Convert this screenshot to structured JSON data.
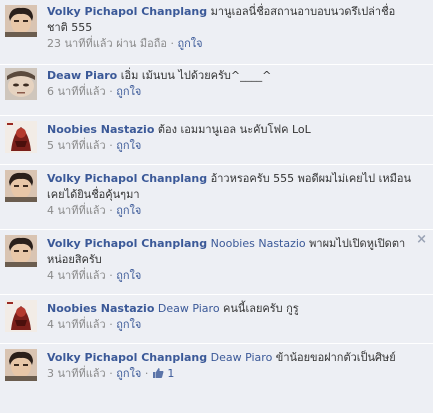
{
  "comments": [
    {
      "author": "Volky Pichapol Chanplang",
      "text": " มานูเอลนี่ชื่อสถานอาบอบนวดรึเปล่าชื่อชาติ 555",
      "time": "23 นาทีที่แล้ว",
      "via": "ผ่าน มือถือ",
      "like": "ถูกใจ",
      "avatar": "avatar-volky"
    },
    {
      "author": "Deaw Piaro",
      "text": " เอิ่ม เม้นบน ไปด้วยครับ^____^",
      "time": "6 นาทีที่แล้ว",
      "like": "ถูกใจ",
      "avatar": "avatar-deaw"
    },
    {
      "author": "Noobies Nastazio",
      "text": " ต้อง เอมมานูเอล นะคับโฟค LoL",
      "time": "5 นาทีที่แล้ว",
      "like": "ถูกใจ",
      "avatar": "avatar-noobies"
    },
    {
      "author": "Volky Pichapol Chanplang",
      "text": " อ้าวหรอครับ 555 พอดีผมไม่เคยไป เหมือนเคยได้ยินชื่อคุ้นๆมา",
      "time": "4 นาทีที่แล้ว",
      "like": "ถูกใจ",
      "avatar": "avatar-volky"
    },
    {
      "author": "Volky Pichapol Chanplang",
      "mention": "Noobies Nastazio",
      "text": " พาผมไปเปิดหูเปิดตาหน่อยสิครับ",
      "time": "4 นาทีที่แล้ว",
      "like": "ถูกใจ",
      "avatar": "avatar-volky",
      "close": "×"
    },
    {
      "author": "Noobies Nastazio",
      "mention": "Deaw Piaro",
      "text": " คนนี้เลยครับ กูรู",
      "time": "4 นาทีที่แล้ว",
      "like": "ถูกใจ",
      "avatar": "avatar-noobies"
    },
    {
      "author": "Volky Pichapol Chanplang",
      "mention": "Deaw Piaro",
      "text": " ข้าน้อยขอฝากตัวเป็นศิษย์",
      "time": "3 นาทีที่แล้ว",
      "like": "ถูกใจ",
      "like_count": "1",
      "avatar": "avatar-volky"
    }
  ],
  "separator": " · ",
  "colors": {
    "background": "#edeff4",
    "link": "#3b5998",
    "meta": "#8a8a8a",
    "divider": "#ffffff"
  }
}
